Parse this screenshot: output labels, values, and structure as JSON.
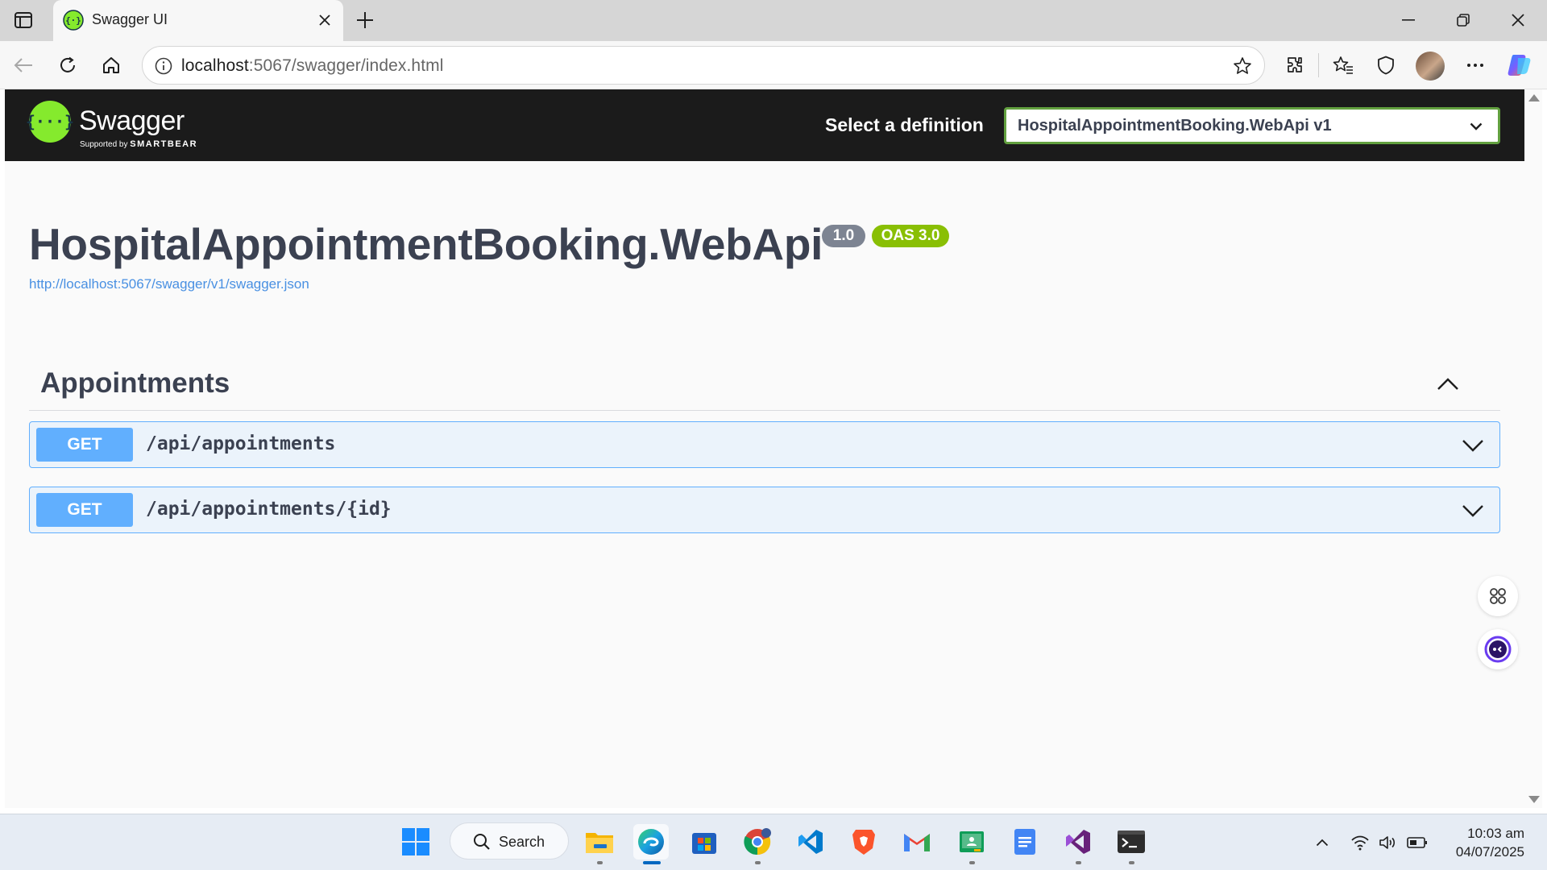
{
  "browser": {
    "tab_title": "Swagger UI",
    "url_host": "localhost",
    "url_rest": ":5067/swagger/index.html"
  },
  "swagger": {
    "brand": "Swagger",
    "supported_by": "Supported by",
    "smartbear": "SMARTBEAR",
    "select_label": "Select a definition",
    "selected_definition": "HospitalAppointmentBooking.WebApi v1",
    "title": "HospitalAppointmentBooking.WebApi",
    "version_badge": "1.0",
    "oas_badge": "OAS 3.0",
    "spec_url": "http://localhost:5067/swagger/v1/swagger.json",
    "tag": "Appointments",
    "operations": [
      {
        "method": "GET",
        "path": "/api/appointments"
      },
      {
        "method": "GET",
        "path": "/api/appointments/{id}"
      }
    ]
  },
  "taskbar": {
    "search_label": "Search",
    "time": "10:03 am",
    "date": "04/07/2025"
  },
  "colors": {
    "swagger_green": "#85ea2d",
    "get_blue": "#61affe",
    "oas_badge": "#89bf04",
    "topbar_bg": "#1b1b1b"
  },
  "icons": [
    "tab-actions-icon",
    "swagger-favicon",
    "close-icon",
    "plus-icon",
    "minimize-icon",
    "restore-icon",
    "back-icon",
    "refresh-icon",
    "home-icon",
    "info-icon",
    "star-icon",
    "extensions-icon",
    "favorites-icon",
    "shield-icon",
    "more-icon",
    "copilot-icon",
    "chevron-down-icon",
    "chevron-up-icon",
    "apps-icon",
    "assistant-icon",
    "windows-start-icon",
    "search-icon",
    "file-explorer-icon",
    "edge-icon",
    "store-icon",
    "chrome-icon",
    "vscode-icon",
    "brave-icon",
    "gmail-icon",
    "classroom-icon",
    "docs-icon",
    "visual-studio-icon",
    "terminal-icon",
    "wifi-icon",
    "volume-icon",
    "battery-icon"
  ]
}
